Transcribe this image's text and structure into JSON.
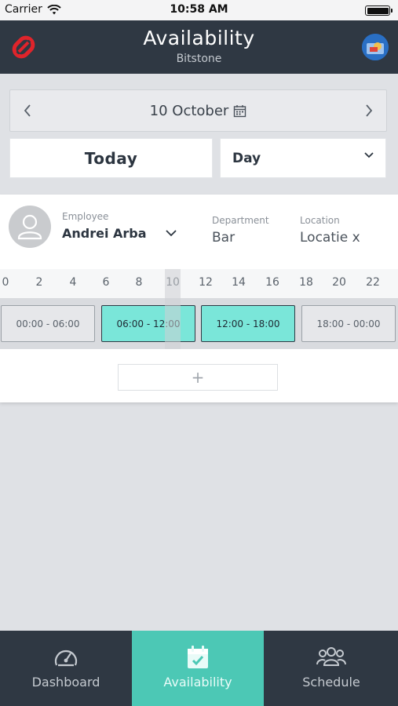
{
  "status_bar": {
    "carrier": "Carrier",
    "time": "10:58 AM"
  },
  "header": {
    "title": "Availability",
    "subtitle": "Bitstone"
  },
  "date_nav": {
    "date": "10 October"
  },
  "controls": {
    "today_label": "Today",
    "view_value": "Day"
  },
  "employee": {
    "employee_label": "Employee",
    "employee_name": "Andrei Arba",
    "department_label": "Department",
    "department_value": "Bar",
    "location_label": "Location",
    "location_value": "Locatie x"
  },
  "timeline": {
    "hours": [
      "0",
      "2",
      "4",
      "6",
      "8",
      "10",
      "12",
      "14",
      "16",
      "18",
      "20",
      "22"
    ],
    "current_hour": "10"
  },
  "slots": [
    {
      "label": "00:00 - 06:00",
      "selected": false
    },
    {
      "label": "06:00 - 12:00",
      "selected": true
    },
    {
      "label": "12:00 - 18:00",
      "selected": true
    },
    {
      "label": "18:00 - 00:00",
      "selected": false
    }
  ],
  "add_label": "+",
  "tabs": [
    {
      "label": "Dashboard",
      "icon": "speedometer-icon",
      "active": false
    },
    {
      "label": "Availability",
      "icon": "calendar-check-icon",
      "active": true
    },
    {
      "label": "Schedule",
      "icon": "group-icon",
      "active": false
    }
  ],
  "colors": {
    "header_bg": "#2f3843",
    "accent": "#4cc8b5",
    "slot_selected": "#7ae6d9",
    "logo_red": "#e0242b"
  }
}
